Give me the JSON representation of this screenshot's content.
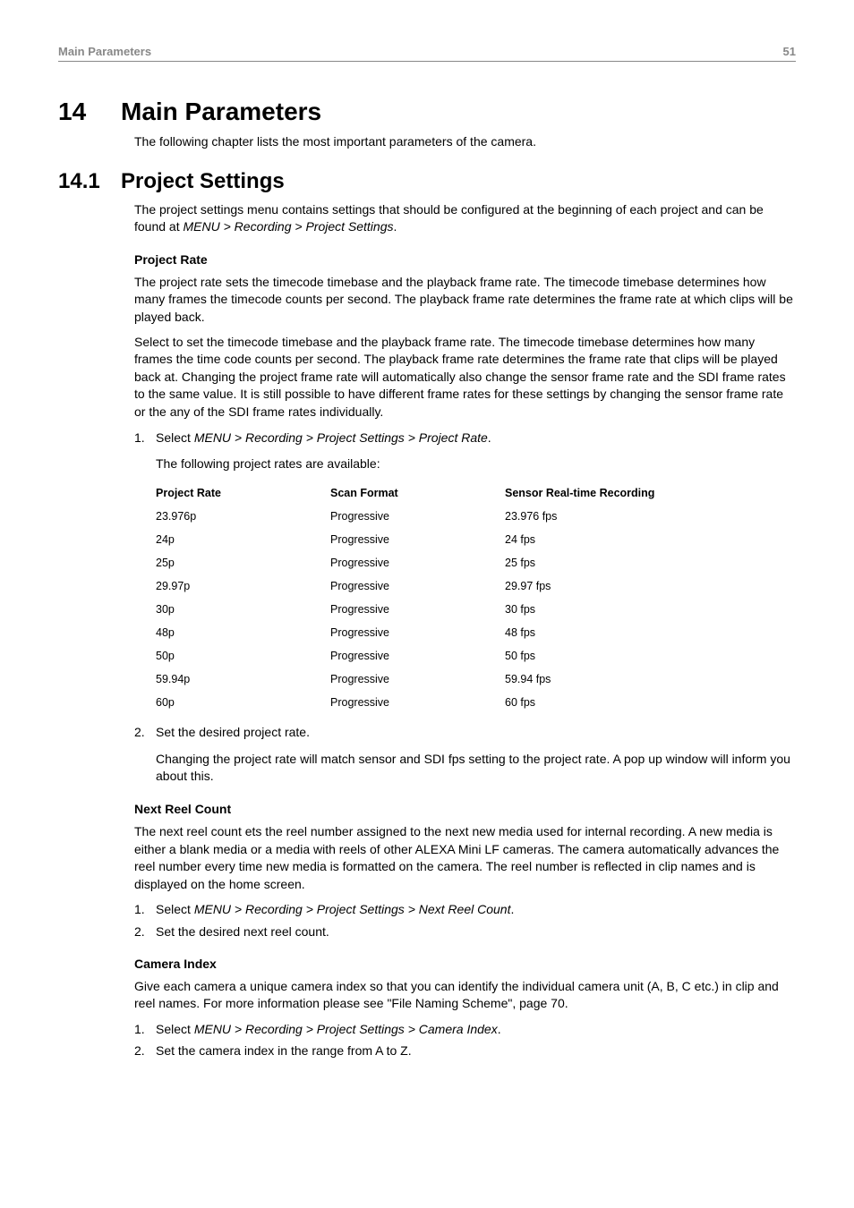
{
  "header": {
    "title": "Main Parameters",
    "page": "51"
  },
  "chapter": {
    "num": "14",
    "title": "Main Parameters",
    "intro": "The following chapter lists the most important parameters of the camera."
  },
  "section": {
    "num": "14.1",
    "title": "Project Settings",
    "intro_a": "The project settings menu contains settings that should be configured at the beginning of each project and can be found at ",
    "intro_b": "MENU > Recording > Project Settings",
    "intro_c": "."
  },
  "project_rate": {
    "head": "Project Rate",
    "p1": "The project rate sets the timecode timebase and the playback frame rate. The timecode timebase determines how many frames the timecode counts per second. The playback frame rate determines the frame rate at which clips will be played back.",
    "p2": "Select to set the timecode timebase and the playback frame rate. The timecode timebase determines how many frames the time code counts per second. The playback frame rate determines the frame rate that clips will be played back at. Changing the project frame rate will automatically also change the sensor frame rate and the SDI frame rates to the same value. It is still possible to have different frame rates for these settings by changing the sensor frame rate or the any of the SDI frame rates individually.",
    "step1_a": "Select ",
    "step1_b": "MENU > Recording > Project Settings > Project Rate",
    "step1_c": ".",
    "step1_sub": "The following project rates are available:",
    "th1": "Project Rate",
    "th2": "Scan Format",
    "th3": "Sensor Real-time Recording",
    "rows": [
      {
        "r": "23.976p",
        "s": "Progressive",
        "f": "23.976 fps"
      },
      {
        "r": "24p",
        "s": "Progressive",
        "f": "24 fps"
      },
      {
        "r": "25p",
        "s": "Progressive",
        "f": "25 fps"
      },
      {
        "r": "29.97p",
        "s": "Progressive",
        "f": "29.97 fps"
      },
      {
        "r": "30p",
        "s": "Progressive",
        "f": "30 fps"
      },
      {
        "r": "48p",
        "s": "Progressive",
        "f": "48 fps"
      },
      {
        "r": "50p",
        "s": "Progressive",
        "f": "50 fps"
      },
      {
        "r": "59.94p",
        "s": "Progressive",
        "f": "59.94 fps"
      },
      {
        "r": "60p",
        "s": "Progressive",
        "f": "60 fps"
      }
    ],
    "step2": "Set the desired project rate.",
    "step2_sub": "Changing the project rate will match sensor and SDI fps setting to the project rate. A pop up window will inform you about this."
  },
  "next_reel": {
    "head": "Next Reel Count",
    "p1": "The next reel count ets the reel number assigned to the next new media used for internal recording. A new media is either a blank media or a media with reels of other ALEXA Mini LF cameras. The camera automatically advances the reel number every time new media is formatted on the camera. The reel number is reflected in clip names and is displayed on the home screen.",
    "step1_a": "Select ",
    "step1_b": "MENU > Recording > Project Settings > Next Reel Count",
    "step1_c": ".",
    "step2": "Set the desired next reel count."
  },
  "camera_index": {
    "head": "Camera Index",
    "p1": "Give each camera a unique camera index so that you can identify the individual camera unit (A, B, C etc.) in clip and reel names. For more information please see \"File Naming Scheme\", page 70.",
    "step1_a": "Select ",
    "step1_b": "MENU > Recording > Project Settings > Camera Index",
    "step1_c": ".",
    "step2": "Set the camera index in the range from A to Z."
  }
}
